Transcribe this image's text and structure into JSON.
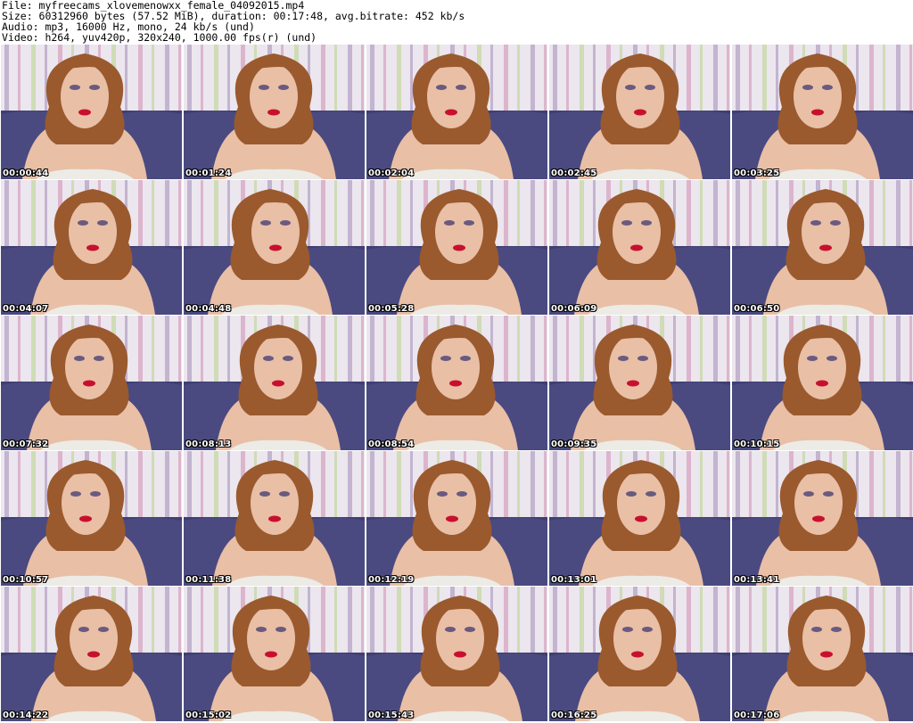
{
  "header": {
    "file": "File: myfreecams_xlovemenowxx_female_04092015.mp4",
    "size": "Size: 60312960 bytes (57.52 MiB), duration: 00:17:48, avg.bitrate: 452 kb/s",
    "audio": "Audio: mp3, 16000 Hz, mono, 24 kb/s (und)",
    "video": "Video: h264, yuv420p, 320x240, 1000.00 fps(r) (und)"
  },
  "thumbnails": [
    {
      "timestamp": "00:00:44"
    },
    {
      "timestamp": "00:01:24"
    },
    {
      "timestamp": "00:02:04"
    },
    {
      "timestamp": "00:02:45"
    },
    {
      "timestamp": "00:03:25"
    },
    {
      "timestamp": "00:04:07"
    },
    {
      "timestamp": "00:04:48"
    },
    {
      "timestamp": "00:05:28"
    },
    {
      "timestamp": "00:06:09"
    },
    {
      "timestamp": "00:06:50"
    },
    {
      "timestamp": "00:07:32"
    },
    {
      "timestamp": "00:08:13"
    },
    {
      "timestamp": "00:08:54"
    },
    {
      "timestamp": "00:09:35"
    },
    {
      "timestamp": "00:10:15"
    },
    {
      "timestamp": "00:10:57"
    },
    {
      "timestamp": "00:11:38"
    },
    {
      "timestamp": "00:12:19"
    },
    {
      "timestamp": "00:13:01"
    },
    {
      "timestamp": "00:13:41"
    },
    {
      "timestamp": "00:14:22"
    },
    {
      "timestamp": "00:15:02"
    },
    {
      "timestamp": "00:15:43"
    },
    {
      "timestamp": "00:16:25"
    },
    {
      "timestamp": "00:17:06"
    }
  ],
  "colors": {
    "wall": "#ece6ee",
    "stripe_purple": "#b9a7c8",
    "stripe_pink": "#d8a9c4",
    "stripe_green": "#c8d9a8",
    "sofa": "#3f3f72",
    "skin": "#e9bfa6",
    "hair": "#9a5a2e",
    "lips": "#c8102e",
    "bra": "#ecebe6",
    "timestamp_text": "#ffffff"
  }
}
